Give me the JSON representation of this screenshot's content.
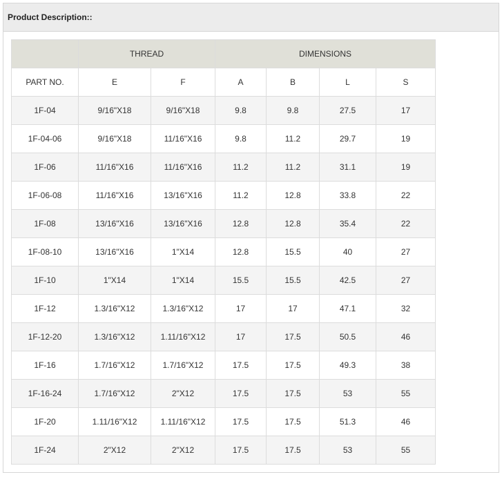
{
  "header": {
    "title": "Product Description::"
  },
  "table": {
    "group_headers": {
      "blank": "",
      "thread": "THREAD",
      "dimensions": "DIMENSIONS"
    },
    "columns": [
      "PART NO.",
      "E",
      "F",
      "A",
      "B",
      "L",
      "S"
    ],
    "rows": [
      [
        "1F-04",
        "9/16\"X18",
        "9/16\"X18",
        "9.8",
        "9.8",
        "27.5",
        "17"
      ],
      [
        "1F-04-06",
        "9/16\"X18",
        "11/16\"X16",
        "9.8",
        "11.2",
        "29.7",
        "19"
      ],
      [
        "1F-06",
        "11/16\"X16",
        "11/16\"X16",
        "11.2",
        "11.2",
        "31.1",
        "19"
      ],
      [
        "1F-06-08",
        "11/16\"X16",
        "13/16\"X16",
        "11.2",
        "12.8",
        "33.8",
        "22"
      ],
      [
        "1F-08",
        "13/16\"X16",
        "13/16\"X16",
        "12.8",
        "12.8",
        "35.4",
        "22"
      ],
      [
        "1F-08-10",
        "13/16\"X16",
        "1\"X14",
        "12.8",
        "15.5",
        "40",
        "27"
      ],
      [
        "1F-10",
        "1\"X14",
        "1\"X14",
        "15.5",
        "15.5",
        "42.5",
        "27"
      ],
      [
        "1F-12",
        "1.3/16\"X12",
        "1.3/16\"X12",
        "17",
        "17",
        "47.1",
        "32"
      ],
      [
        "1F-12-20",
        "1.3/16\"X12",
        "1.11/16\"X12",
        "17",
        "17.5",
        "50.5",
        "46"
      ],
      [
        "1F-16",
        "1.7/16\"X12",
        "1.7/16\"X12",
        "17.5",
        "17.5",
        "49.3",
        "38"
      ],
      [
        "1F-16-24",
        "1.7/16\"X12",
        "2\"X12",
        "17.5",
        "17.5",
        "53",
        "55"
      ],
      [
        "1F-20",
        "1.11/16\"X12",
        "1.11/16\"X12",
        "17.5",
        "17.5",
        "51.3",
        "46"
      ],
      [
        "1F-24",
        "2\"X12",
        "2\"X12",
        "17.5",
        "17.5",
        "53",
        "55"
      ]
    ]
  },
  "colors": {
    "header_bg": "#ececec",
    "group_header_bg": "#e0e0d8",
    "alt_row_bg": "#f4f4f4",
    "border": "#dcdcdc"
  }
}
